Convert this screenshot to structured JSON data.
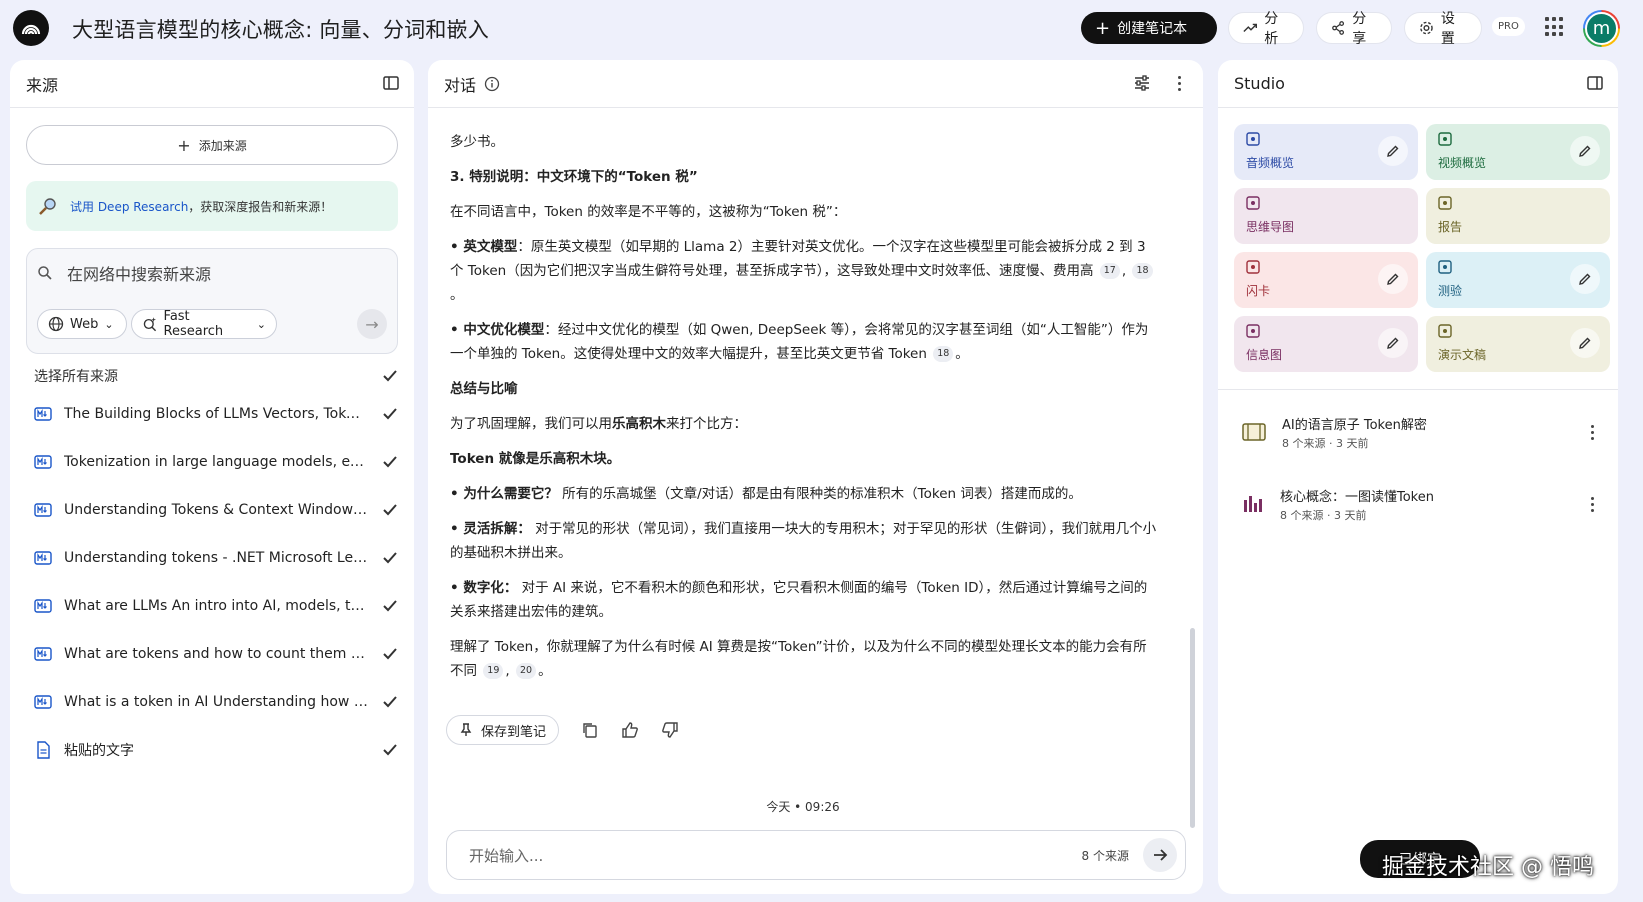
{
  "header": {
    "title": "大型语言模型的核心概念: 向量、分词和嵌入",
    "create_label": "创建笔记本",
    "analyze_label": "分析",
    "share_label": "分享",
    "settings_label": "设置",
    "pro_label": "PRO",
    "avatar_letter": "m"
  },
  "sources": {
    "title": "来源",
    "add_label": "添加来源",
    "deep_research_prefix": "试用 Deep Research",
    "deep_research_suffix": "，获取深度报告和新来源！",
    "search_placeholder": "在网络中搜索新来源",
    "chip_web": "Web",
    "chip_fast": "Fast Research",
    "select_all": "选择所有来源",
    "items": [
      {
        "title": "The Building Blocks of LLMs Vectors, Tokens..."
      },
      {
        "title": "Tokenization in large language models, expl..."
      },
      {
        "title": "Understanding Tokens & Context Windows...."
      },
      {
        "title": "Understanding tokens - .NET Microsoft Lear..."
      },
      {
        "title": "What are LLMs An intro into AI, models, toke..."
      },
      {
        "title": "What are tokens and how to count them Op..."
      },
      {
        "title": "What is a token in AI Understanding how AI ..."
      },
      {
        "title": "粘贴的文字"
      }
    ]
  },
  "chat": {
    "title": "对话",
    "p_top": "多少书。",
    "h3": "3. 特别说明：中文环境下的“Token 税”",
    "p_tax": "在不同语言中，Token 的效率是不平等的，这被称为“Token 税”：",
    "b1_label": "• 英文模型",
    "b1_text": "：原生英文模型（如早期的 Llama 2）主要针对英文优化。一个汉字在这些模型里可能会被拆分成 2 到 3 个 Token（因为它们把汉字当成生僻符号处理，甚至拆成字节），这导致处理中文时效率低、速度慢、费用高",
    "b1_c1": "17",
    "b1_c2": "18",
    "b2_label": "• 中文优化模型",
    "b2_text": "：经过中文优化的模型（如 Qwen, DeepSeek 等），会将常见的汉字甚至词组（如“人工智能”）作为一个单独的 Token。这使得处理中文的效率大幅提升，甚至比英文更节省 Token",
    "b2_c1": "18",
    "h_summary": "总结与比喻",
    "p_lego_pre": "为了巩固理解，我们可以用",
    "p_lego_bold": "乐高积木",
    "p_lego_post": "来打个比方：",
    "p_token_lego": "Token 就像是乐高积木块。",
    "b3_label": "• 为什么需要它？",
    "b3_text": " 所有的乐高城堡（文章/对话）都是由有限种类的标准积木（Token 词表）搭建而成的。",
    "b4_label": "• 灵活拆解：",
    "b4_text": " 对于常见的形状（常见词），我们直接用一块大的专用积木；对于罕见的形状（生僻词），我们就用几个小的基础积木拼出来。",
    "b5_label": "• 数字化：",
    "b5_text": " 对于 AI 来说，它不看积木的颜色和形状，它只看积木侧面的编号（Token ID），然后通过计算编号之间的关系来搭建出宏伟的建筑。",
    "p_final": "理解了 Token，你就理解了为什么有时候 AI 算费是按“Token”计价，以及为什么不同的模型处理长文本的能力会有所不同",
    "final_c1": "19",
    "final_c2": "20",
    "save_label": "保存到笔记",
    "timestamp": "今天 • 09:26",
    "input_placeholder": "开始输入...",
    "source_count": "8 个来源"
  },
  "studio": {
    "title": "Studio",
    "tiles": [
      {
        "label": "音频概览",
        "color": "#e6eaf8",
        "text_color": "#2c4aa5"
      },
      {
        "label": "视频概览",
        "color": "#dcefe4",
        "text_color": "#1d6b3e"
      },
      {
        "label": "思维导图",
        "color": "#f1e6ee",
        "text_color": "#7a2f62"
      },
      {
        "label": "报告",
        "color": "#f0efdf",
        "text_color": "#6b6528"
      },
      {
        "label": "闪卡",
        "color": "#fbe6e6",
        "text_color": "#a0313b"
      },
      {
        "label": "测验",
        "color": "#dcf0f6",
        "text_color": "#1f6080"
      },
      {
        "label": "信息图",
        "color": "#f1e6ee",
        "text_color": "#7a2f62"
      },
      {
        "label": "演示文稿",
        "color": "#f0efdf",
        "text_color": "#6b6528"
      }
    ],
    "notes": [
      {
        "title": "AI的语言原子 Token解密",
        "meta": "8 个来源 · 3 天前"
      },
      {
        "title": "核心概念：一图读懂Token",
        "meta": "8 个来源 · 3 天前"
      }
    ]
  },
  "watermark": {
    "button": "已绑定",
    "text": "掘金技术社区 @ 悟鸣"
  }
}
